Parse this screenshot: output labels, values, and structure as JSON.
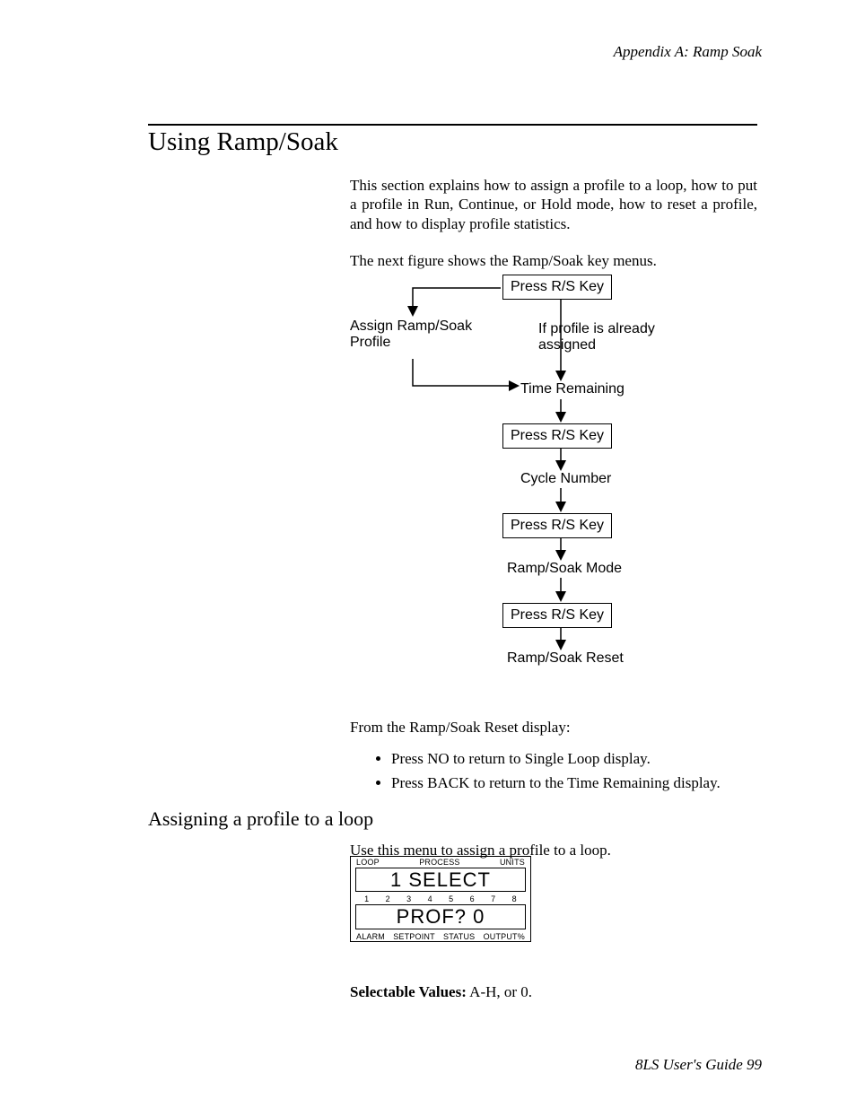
{
  "header": {
    "appendix": "Appendix A: Ramp Soak"
  },
  "title": "Using Ramp/Soak",
  "intro_p1": "This section explains how to assign a profile to a loop, how to put a profile in Run, Continue, or Hold mode, how to reset a profile, and how to display profile statistics.",
  "intro_p2": "The next figure shows the Ramp/Soak key menus.",
  "flow": {
    "start": "Press R/S Key",
    "assign_label_l1": "Assign Ramp/Soak",
    "assign_label_l2": "Profile",
    "if_assigned_l1": "If profile is already",
    "if_assigned_l2": "assigned",
    "time_remaining": "Time Remaining",
    "press2": "Press R/S Key",
    "cycle": "Cycle Number",
    "press3": "Press R/S Key",
    "mode": "Ramp/Soak Mode",
    "press4": "Press R/S Key",
    "reset": "Ramp/Soak Reset"
  },
  "after_flow_p": "From the Ramp/Soak Reset display:",
  "bullets": {
    "b1": "Press NO to return to Single Loop display.",
    "b2": "Press BACK to return to the Time Remaining display."
  },
  "h2": "Assigning a profile to a loop",
  "assign_intro": "Use this menu to assign a profile to a loop.",
  "device": {
    "top": {
      "loop": "LOOP",
      "process": "PROCESS",
      "units": "UNITS"
    },
    "lcd_top": "1 SELECT",
    "mid": [
      "1",
      "2",
      "3",
      "4",
      "5",
      "6",
      "7",
      "8"
    ],
    "lcd_bot": "PROF? 0",
    "bot": {
      "alarm": "ALARM",
      "setpoint": "SETPOINT",
      "status": "STATUS",
      "output": "OUTPUT%"
    }
  },
  "selectable_label": "Selectable Values:",
  "selectable_vals": " A-H, or 0.",
  "footer": "8LS User's Guide 99"
}
